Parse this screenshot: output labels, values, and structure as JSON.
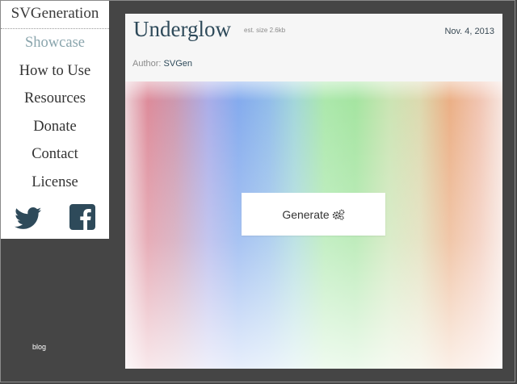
{
  "sidebar": {
    "brand": "SVGeneration",
    "items": [
      {
        "label": "Showcase",
        "active": true
      },
      {
        "label": "How to Use"
      },
      {
        "label": "Resources"
      },
      {
        "label": "Donate"
      },
      {
        "label": "Contact"
      },
      {
        "label": "License"
      }
    ],
    "social": [
      "twitter-icon",
      "facebook-icon"
    ],
    "blog_link": "blog"
  },
  "pattern": {
    "title": "Underglow",
    "est_size": "est. size 2.6kb",
    "date": "Nov. 4, 2013",
    "author_label": "Author:",
    "author_name": "SVGen",
    "generate_label": "Generate",
    "generate_icon": "gears-icon"
  },
  "colors": {
    "background": "#454545",
    "accent_active": "#8aa5ad",
    "title": "#2e4a5a",
    "twitter": "#2e4a5a",
    "facebook": "#2e4a5a"
  }
}
